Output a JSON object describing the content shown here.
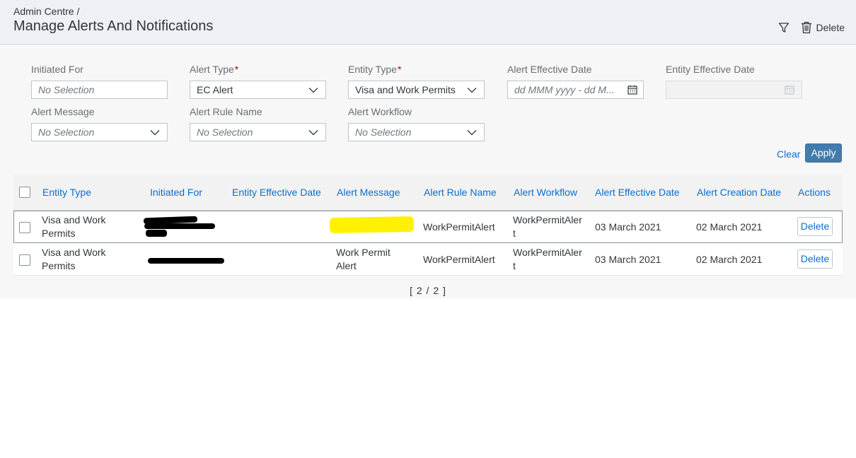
{
  "header": {
    "breadcrumb": "Admin Centre /",
    "title": "Manage Alerts And Notifications",
    "filter_icon": "filter-icon",
    "delete_icon": "trash-icon",
    "delete_label": "Delete"
  },
  "filters": {
    "initiated_for": {
      "label": "Initiated For",
      "placeholder": "No Selection"
    },
    "alert_type": {
      "label": "Alert Type",
      "required": "*",
      "value": "EC Alert"
    },
    "entity_type": {
      "label": "Entity Type",
      "required": "*",
      "value": "Visa and Work Permits"
    },
    "alert_effective_date": {
      "label": "Alert Effective Date",
      "placeholder": "dd MMM yyyy - dd M..."
    },
    "entity_effective_date": {
      "label": "Entity Effective Date",
      "placeholder": ""
    },
    "alert_message": {
      "label": "Alert Message",
      "placeholder": "No Selection"
    },
    "alert_rule_name": {
      "label": "Alert Rule Name",
      "placeholder": "No Selection"
    },
    "alert_workflow": {
      "label": "Alert Workflow",
      "placeholder": "No Selection"
    }
  },
  "actions": {
    "clear": "Clear",
    "apply": "Apply"
  },
  "table": {
    "columns": [
      "Entity Type",
      "Initiated For",
      "Entity Effective Date",
      "Alert Message",
      "Alert Rule Name",
      "Alert Workflow",
      "Alert Effective Date",
      "Alert Creation Date",
      "Actions"
    ],
    "rows": [
      {
        "entity_type_1": "Visa and Work",
        "entity_type_2": "Permits",
        "alert_message_1": "",
        "alert_message_2": "",
        "alert_rule_name": "WorkPermitAlert",
        "alert_workflow_1": "WorkPermitAler",
        "alert_workflow_2": "t",
        "alert_effective_date": "03 March 2021",
        "alert_creation_date": "02 March 2021",
        "action": "Delete"
      },
      {
        "entity_type_1": "Visa and Work",
        "entity_type_2": "Permits",
        "alert_message_1": "Work Permit",
        "alert_message_2": "Alert",
        "alert_rule_name": "WorkPermitAlert",
        "alert_workflow_1": "WorkPermitAler",
        "alert_workflow_2": "t",
        "alert_effective_date": "03 March 2021",
        "alert_creation_date": "02 March 2021",
        "action": "Delete"
      }
    ]
  },
  "pager": "[ 2 / 2 ]"
}
